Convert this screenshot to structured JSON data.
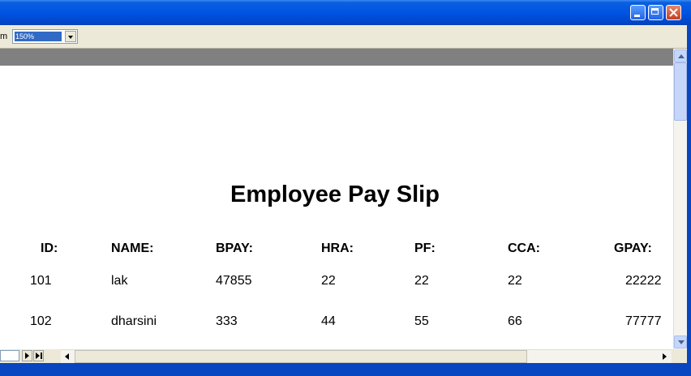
{
  "toolbar": {
    "label_fragment": "m",
    "zoom_value": "150%"
  },
  "report": {
    "title": "Employee Pay Slip",
    "headers": [
      "ID:",
      "NAME:",
      "BPAY:",
      "HRA:",
      "PF:",
      "CCA:",
      "GPAY:"
    ],
    "rows": [
      [
        "101",
        "lak",
        "47855",
        "22",
        "22",
        "22",
        "22222"
      ],
      [
        "102",
        "dharsini",
        "333",
        "44",
        "55",
        "66",
        "77777"
      ]
    ]
  },
  "colors": {
    "titlebar": "#0054e3",
    "toolbar": "#ece9d8",
    "band": "#808080",
    "selection": "#316ac5"
  },
  "icons": [
    "minimize-icon",
    "maximize-icon",
    "close-icon",
    "dropdown-arrow-icon",
    "next-page-icon",
    "last-page-icon",
    "scroll-up-icon",
    "scroll-down-icon",
    "scroll-left-icon",
    "scroll-right-icon"
  ]
}
